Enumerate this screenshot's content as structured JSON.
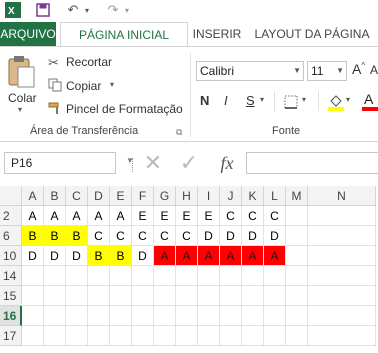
{
  "qat": {
    "app_icon": "excel-icon",
    "save_icon": "save-icon",
    "undo_icon": "undo-icon",
    "redo_icon": "redo-icon"
  },
  "tabs": {
    "file": "ARQUIVO",
    "home": "PÁGINA INICIAL",
    "insert": "INSERIR",
    "layout": "LAYOUT DA PÁGINA"
  },
  "ribbon": {
    "paste_label": "Colar",
    "cut_label": "Recortar",
    "copy_label": "Copiar",
    "format_painter_label": "Pincel de Formatação",
    "clipboard_group": "Área de Transferência",
    "font_name": "Calibri",
    "font_size": "11",
    "bold": "N",
    "italic": "I",
    "underline": "S",
    "font_group": "Fonte",
    "font_color_letter": "A",
    "grow_font": "A",
    "shrink_font": "A"
  },
  "formula_bar": {
    "name_box": "P16",
    "fx": "fx"
  },
  "grid": {
    "columns": [
      "A",
      "B",
      "C",
      "D",
      "E",
      "F",
      "G",
      "H",
      "I",
      "J",
      "K",
      "L",
      "M",
      "N"
    ],
    "rows": [
      {
        "num": "2",
        "cells": [
          "A",
          "A",
          "A",
          "A",
          "A",
          "E",
          "E",
          "E",
          "E",
          "C",
          "C",
          "C",
          "",
          ""
        ]
      },
      {
        "num": "6",
        "cells": [
          "B",
          "B",
          "B",
          "C",
          "C",
          "C",
          "C",
          "C",
          "D",
          "D",
          "D",
          "D",
          "",
          ""
        ]
      },
      {
        "num": "10",
        "cells": [
          "D",
          "D",
          "D",
          "B",
          "B",
          "D",
          "A",
          "A",
          "A",
          "A",
          "A",
          "A",
          "",
          ""
        ]
      },
      {
        "num": "14",
        "cells": [
          "",
          "",
          "",
          "",
          "",
          "",
          "",
          "",
          "",
          "",
          "",
          "",
          "",
          ""
        ]
      },
      {
        "num": "15",
        "cells": [
          "",
          "",
          "",
          "",
          "",
          "",
          "",
          "",
          "",
          "",
          "",
          "",
          "",
          ""
        ]
      },
      {
        "num": "16",
        "cells": [
          "",
          "",
          "",
          "",
          "",
          "",
          "",
          "",
          "",
          "",
          "",
          "",
          "",
          ""
        ]
      },
      {
        "num": "17",
        "cells": [
          "",
          "",
          "",
          "",
          "",
          "",
          "",
          "",
          "",
          "",
          "",
          "",
          "",
          ""
        ]
      }
    ],
    "fills": {
      "yellow": "#ffff00",
      "red": "#ff0000"
    },
    "selected_row": "16"
  }
}
